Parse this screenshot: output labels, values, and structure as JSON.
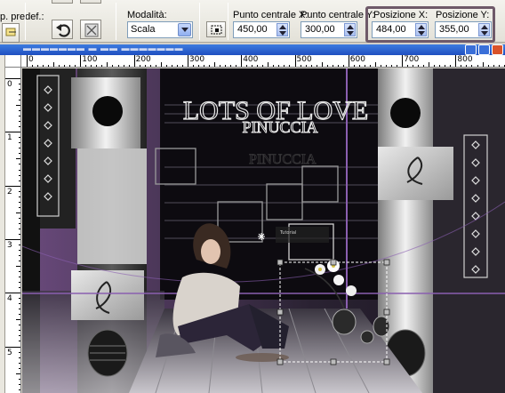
{
  "toolbar": {
    "preset_label": "p. predef.:",
    "mode_label": "Modalità:",
    "mode_value": "Scala",
    "center_x_label": "Punto centrale X:",
    "center_x_value": "450,00",
    "center_y_label": "Punto centrale Y:",
    "center_y_value": "300,00",
    "pos_x_label": "Posizione X:",
    "pos_x_value": "484,00",
    "pos_y_label": "Posizione Y:",
    "pos_y_value": "355,00"
  },
  "ruler": {
    "h_labels": [
      "0",
      "100",
      "200",
      "300",
      "400",
      "500",
      "600",
      "700",
      "800"
    ],
    "v_labels": [
      "0",
      "1",
      "2",
      "3",
      "4",
      "5"
    ]
  },
  "canvas": {
    "title_line1": "LOTS OF LOVE",
    "title_line2": "PINUCCIA",
    "watermark": "Tutorial",
    "colors": {
      "background": "#1a1620",
      "accent_purple": "#8a5fb0",
      "silver": "#d8d8d8"
    }
  }
}
